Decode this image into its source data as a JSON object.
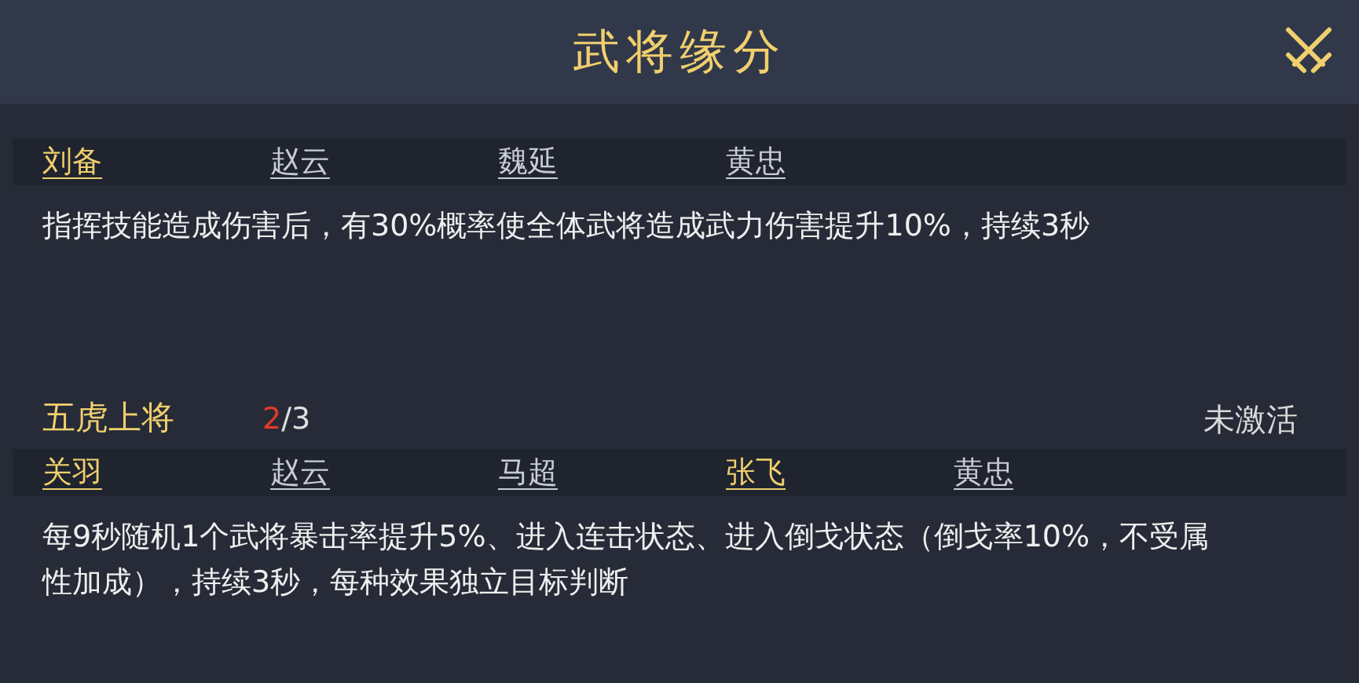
{
  "window": {
    "title": "武将缘分"
  },
  "bonds": [
    {
      "generals": [
        {
          "name": "刘备",
          "owned": true
        },
        {
          "name": "赵云",
          "owned": false
        },
        {
          "name": "魏延",
          "owned": false
        },
        {
          "name": "黄忠",
          "owned": false
        }
      ],
      "description": "指挥技能造成伤害后，有30%概率使全体武将造成武力伤害提升10%，持续3秒"
    },
    {
      "title": "五虎上将",
      "progress_current": "2",
      "progress_total": "/3",
      "status": "未激活",
      "generals": [
        {
          "name": "关羽",
          "owned": true
        },
        {
          "name": "赵云",
          "owned": false
        },
        {
          "name": "马超",
          "owned": false
        },
        {
          "name": "张飞",
          "owned": true
        },
        {
          "name": "黄忠",
          "owned": false
        }
      ],
      "description": "每9秒随机1个武将暴击率提升5%、进入连击状态、进入倒戈状态（倒戈率10%，不受属性加成），持续3秒，每种效果独立目标判断"
    }
  ]
}
